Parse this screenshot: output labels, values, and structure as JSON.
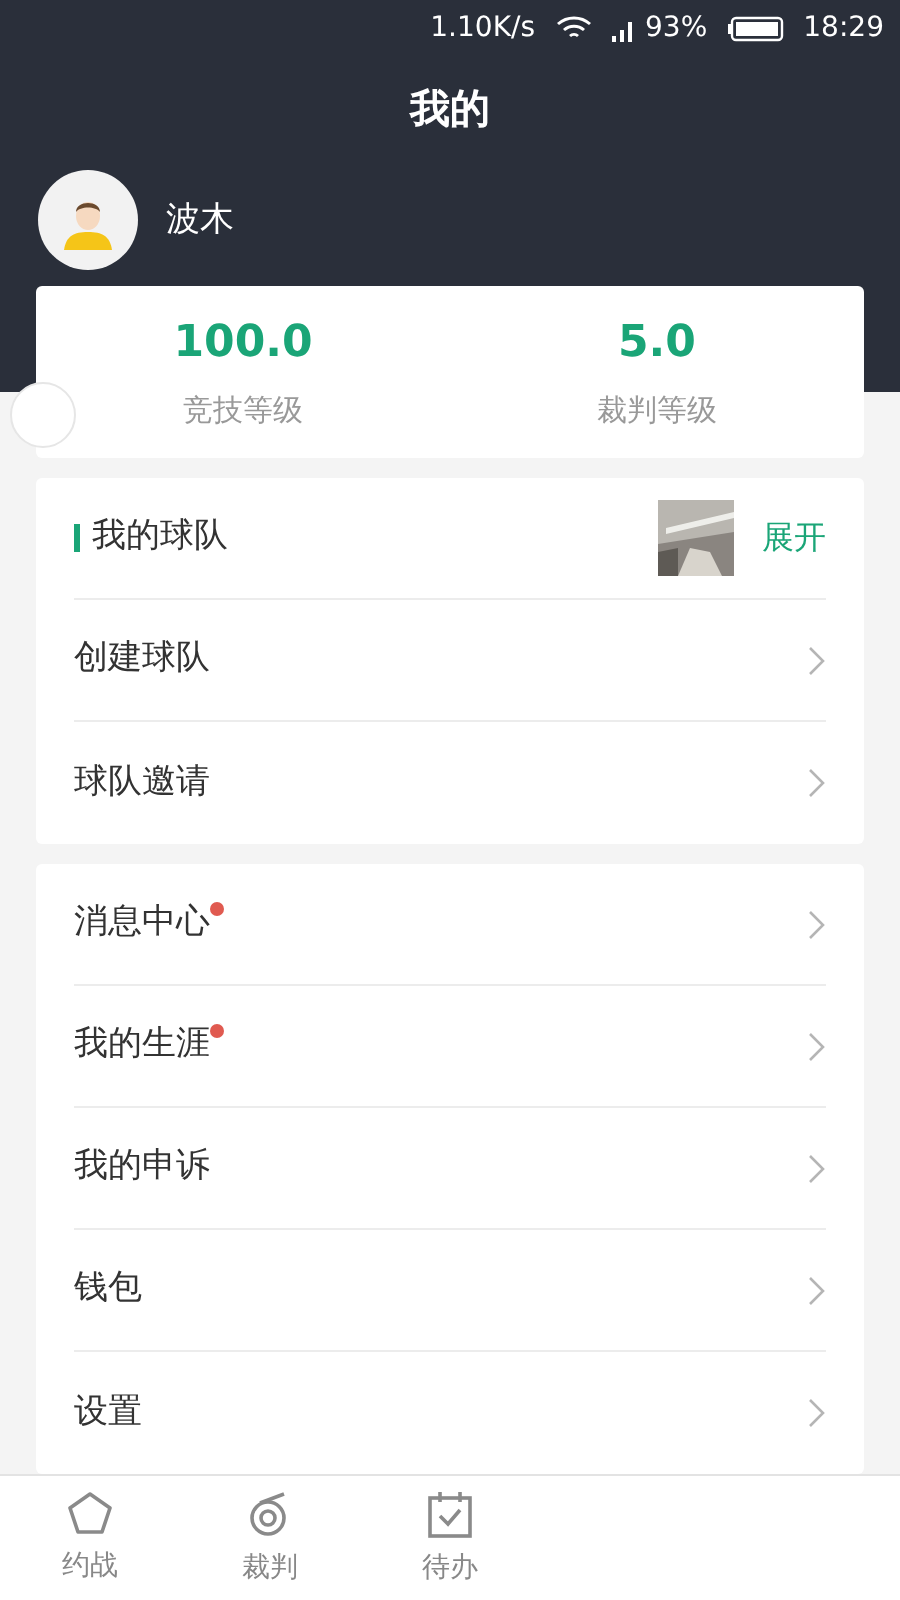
{
  "status_bar": {
    "speed": "1.10K/s",
    "battery": "93%",
    "time": "18:29"
  },
  "header": {
    "title": "我的"
  },
  "profile": {
    "name": "波木"
  },
  "stats": [
    {
      "value": "100.0",
      "label": "竞技等级"
    },
    {
      "value": "5.0",
      "label": "裁判等级"
    }
  ],
  "team_card": {
    "title": "我的球队",
    "expand": "展开",
    "items": [
      {
        "label": "创建球队",
        "badge": false
      },
      {
        "label": "球队邀请",
        "badge": false
      }
    ]
  },
  "menu": [
    {
      "label": "消息中心",
      "badge": true
    },
    {
      "label": "我的生涯",
      "badge": true
    },
    {
      "label": "我的申诉",
      "badge": false
    },
    {
      "label": "钱包",
      "badge": false
    },
    {
      "label": "设置",
      "badge": false
    }
  ],
  "tabs": [
    {
      "label": "约战",
      "selected": false
    },
    {
      "label": "裁判",
      "selected": false
    },
    {
      "label": "待办",
      "selected": false
    }
  ]
}
